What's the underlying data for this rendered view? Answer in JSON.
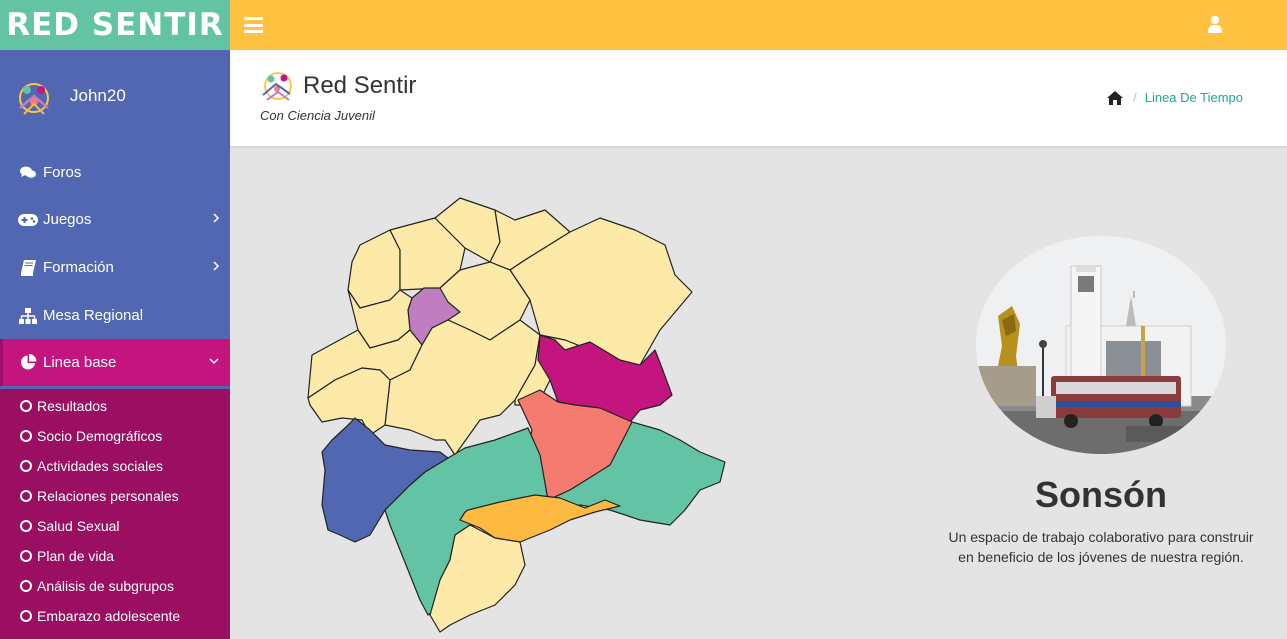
{
  "brand": {
    "title": "RED SENTIR"
  },
  "user": {
    "name": "John20"
  },
  "menu": [
    {
      "label": "Foros",
      "icon": "comments-icon"
    },
    {
      "label": "Juegos",
      "icon": "gamepad-icon"
    },
    {
      "label": "Formación",
      "icon": "book-icon"
    },
    {
      "label": "Mesa Regional",
      "icon": "sitemap-icon"
    },
    {
      "label": "Linea base",
      "icon": "pie-chart-icon"
    }
  ],
  "submenu": [
    {
      "label": "Resultados"
    },
    {
      "label": "Socio Demográficos"
    },
    {
      "label": "Actividades sociales"
    },
    {
      "label": "Relaciones personales"
    },
    {
      "label": "Salud Sexual"
    },
    {
      "label": "Plan de vida"
    },
    {
      "label": "Análisis de subgrupos"
    },
    {
      "label": "Embarazo adolescente"
    }
  ],
  "header": {
    "title": "Red Sentir",
    "subtitle": "Con Ciencia Juvenil",
    "breadcrumb": "Linea De Tiempo"
  },
  "town": {
    "name": "Sonsón",
    "description_line1": "Un espacio de trabajo colaborativo para construir",
    "description_line2": "en beneficio de los jóvenes de nuestra región."
  },
  "colors": {
    "brand_green": "#63c3a5",
    "topbar_yellow": "#ffc341",
    "sidebar_blue": "#5267b2",
    "active_magenta": "#c4157f",
    "submenu_dark": "#9a0f62",
    "link_teal": "#1ea69a",
    "map_cream": "#fdeaa8",
    "map_purple": "#c07ec0",
    "map_magenta": "#c4157f",
    "map_salmon": "#f57b70",
    "map_teal": "#63c3a5",
    "map_blue": "#5267b2",
    "map_orange": "#fdba40"
  }
}
